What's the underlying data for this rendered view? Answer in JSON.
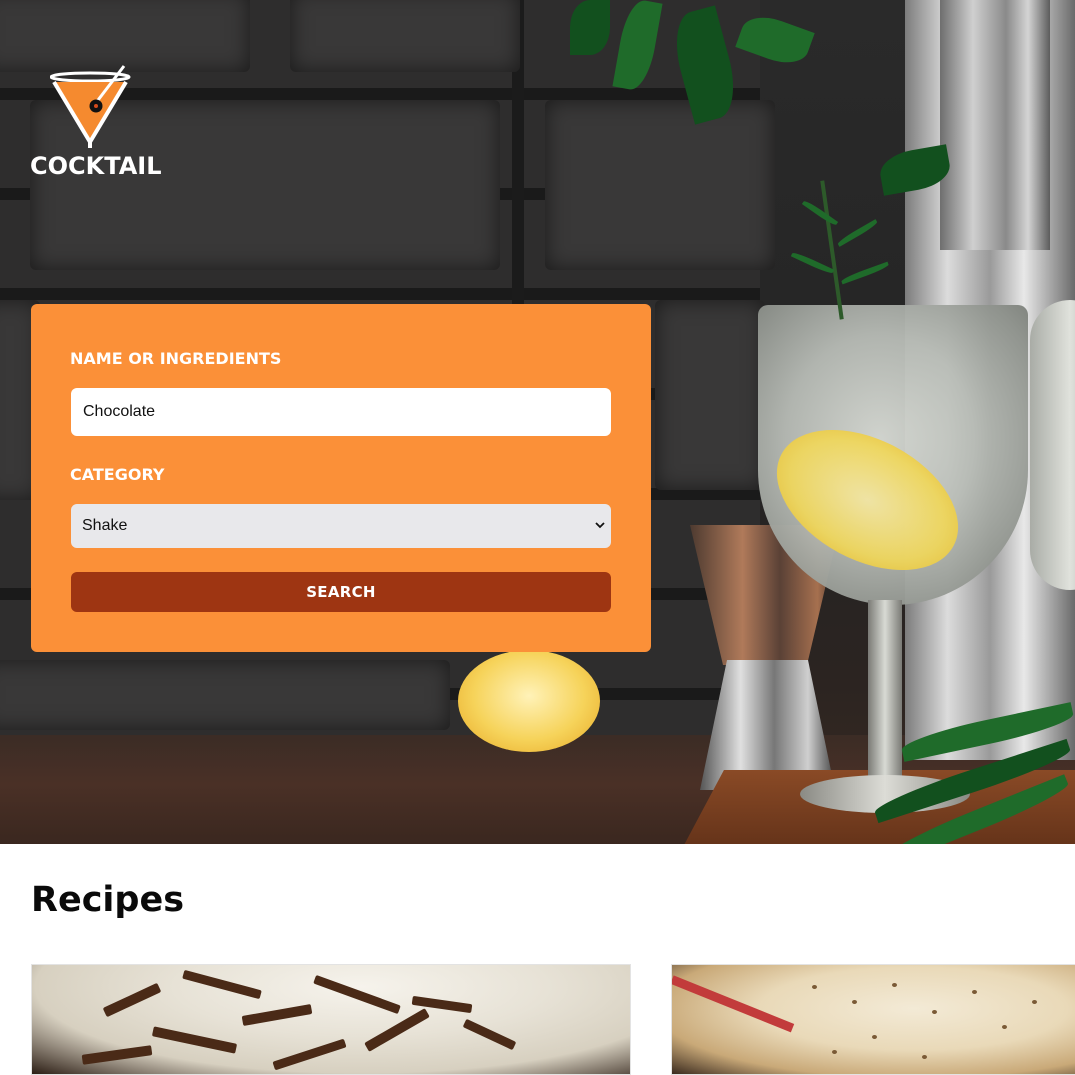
{
  "brand": {
    "name": "COCKTAIL",
    "accent_color": "#fb9038",
    "button_color": "#9e3512"
  },
  "search": {
    "name_label": "NAME OR INGREDIENTS",
    "name_value": "Chocolate",
    "category_label": "CATEGORY",
    "category_selected": "Shake",
    "button_label": "SEARCH"
  },
  "recipes": {
    "title": "Recipes",
    "cards": [
      {
        "image": "chocolate-shake-photo"
      },
      {
        "image": "cream-shake-photo"
      }
    ]
  }
}
